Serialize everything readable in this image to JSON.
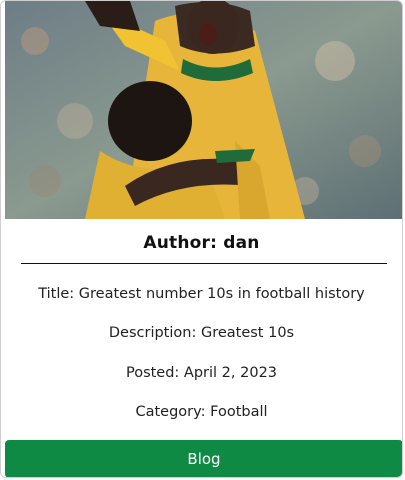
{
  "card": {
    "image_subject": "football-players-celebrating-photo",
    "author_label": "Author: dan",
    "title_line": "Title: Greatest number 10s in football history",
    "description_line": "Description: Greatest 10s",
    "posted_line": "Posted: April 2, 2023",
    "category_line": "Category: Football",
    "button_label": "Blog"
  },
  "colors": {
    "button_bg": "#0f8a44",
    "jersey_yellow": "#f1c232",
    "jersey_green": "#1f6b3a"
  }
}
